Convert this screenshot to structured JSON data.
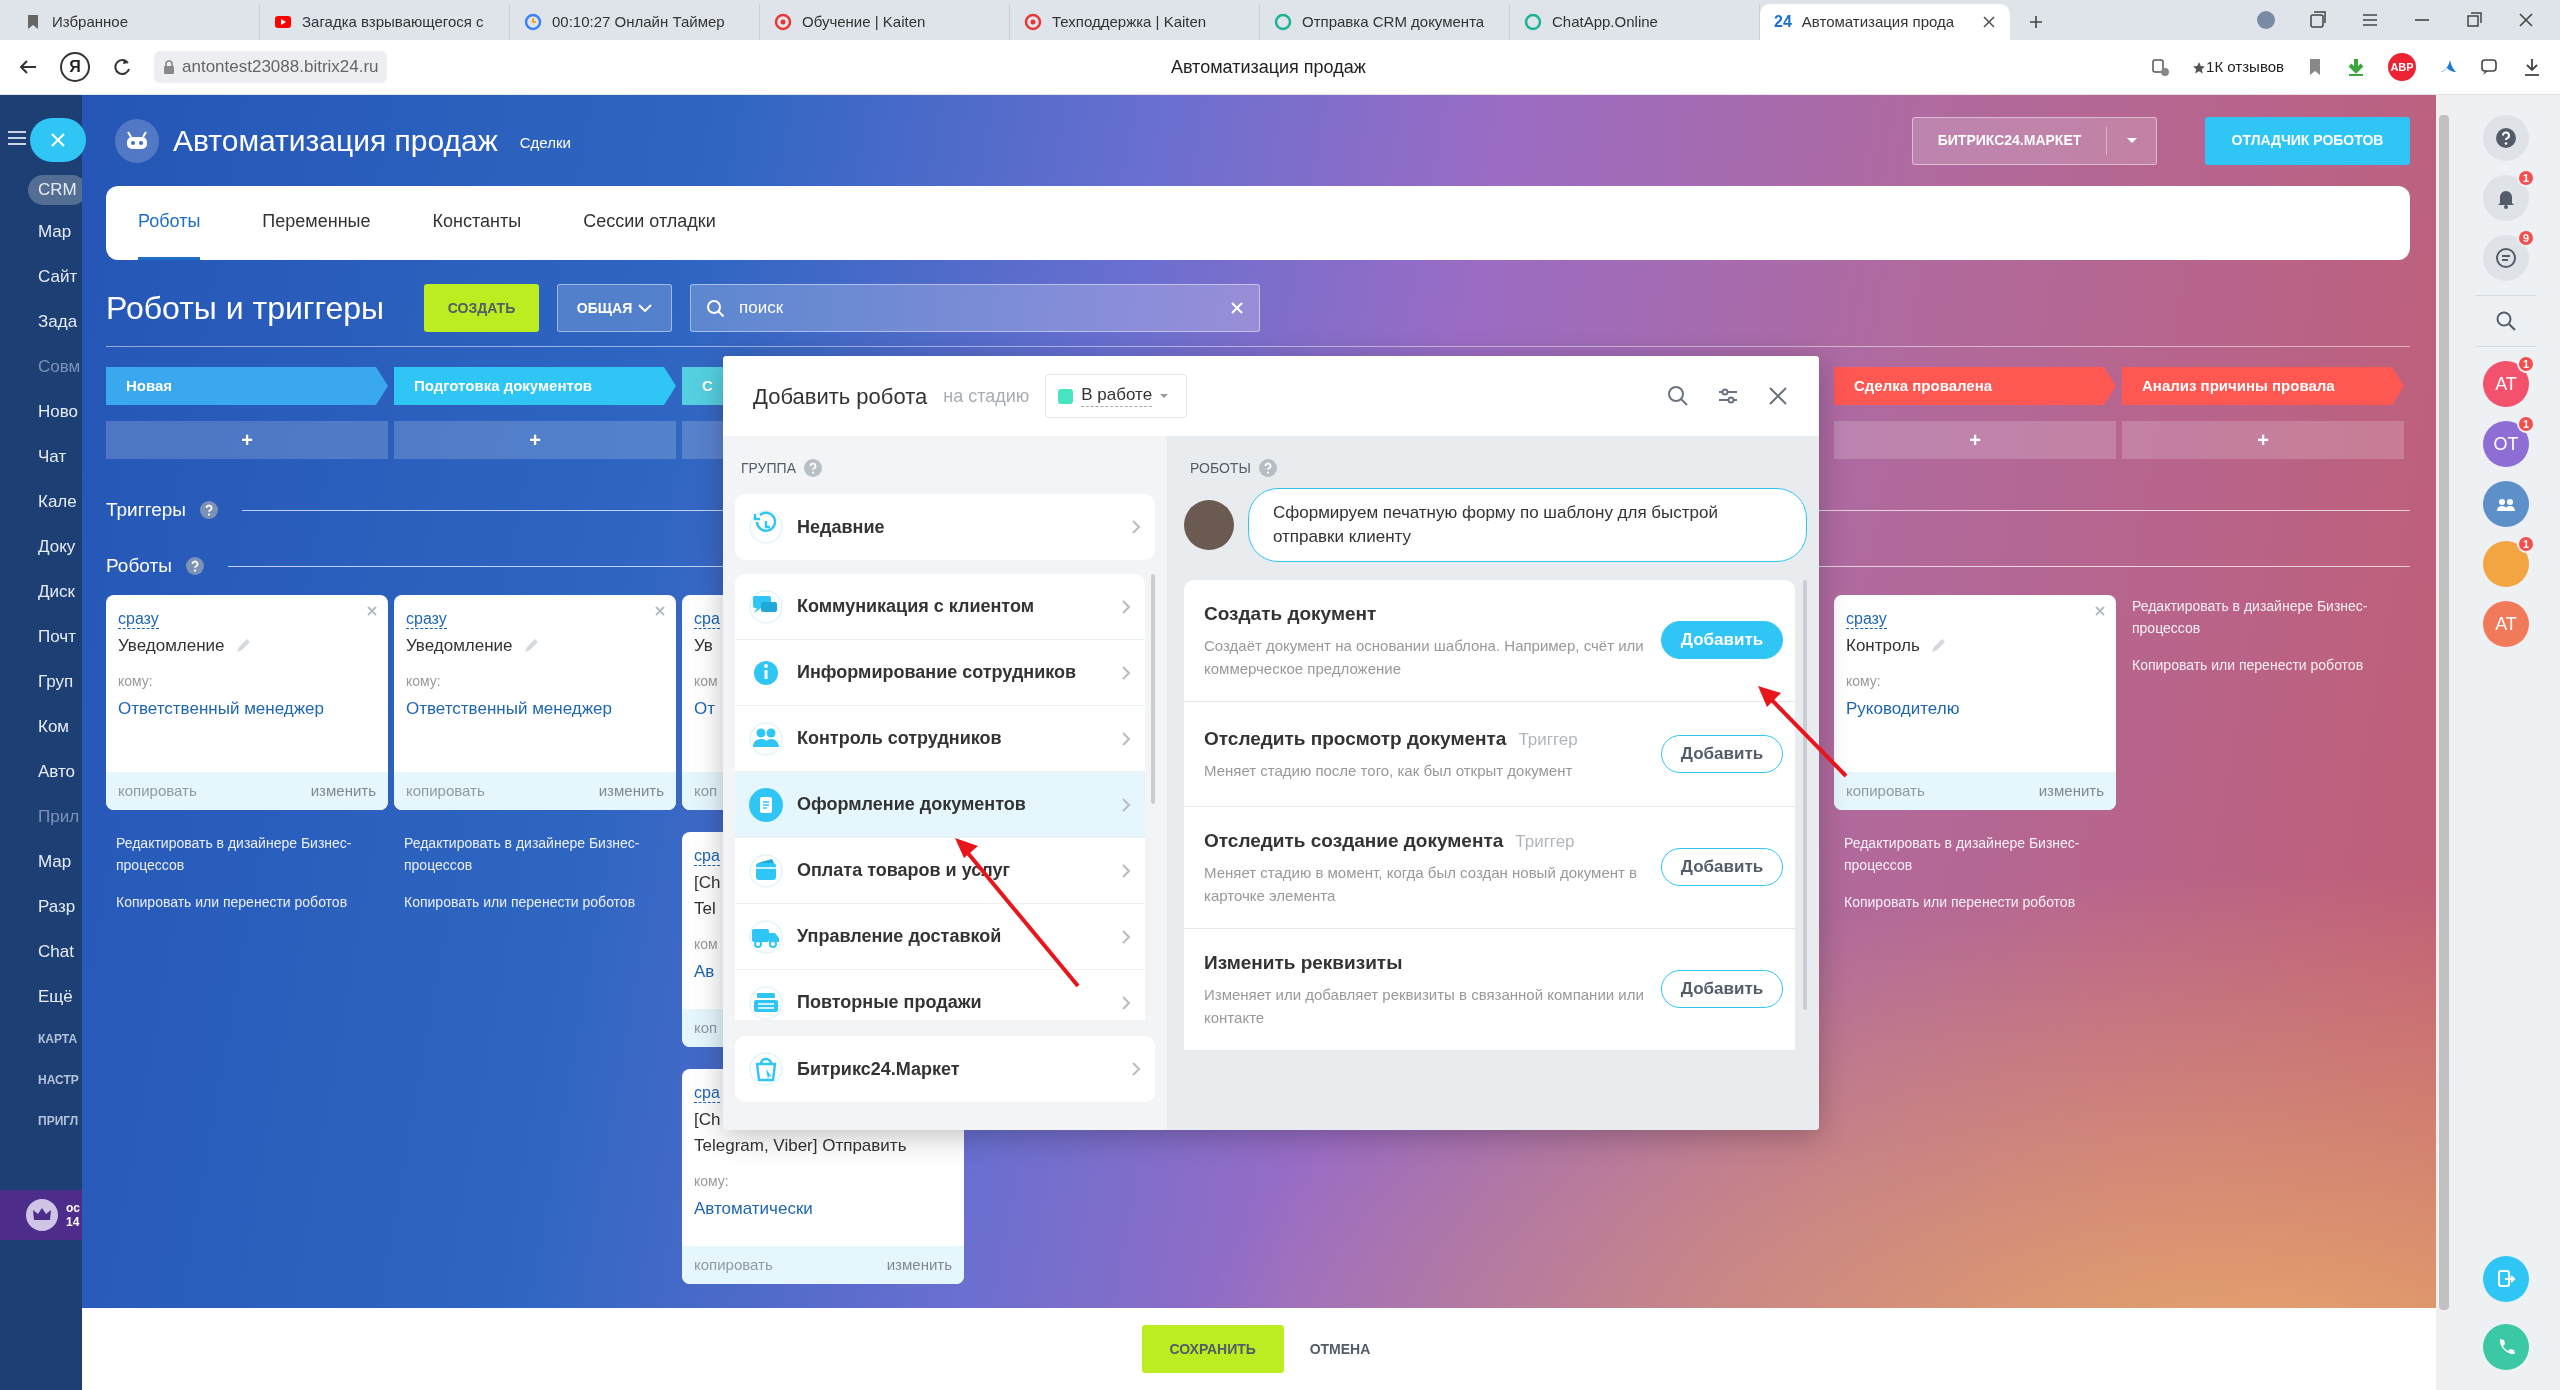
{
  "browser": {
    "tabs": [
      {
        "title": "Избранное",
        "selected": false
      },
      {
        "title": "Загадка взрывающегося с",
        "selected": false
      },
      {
        "title": "00:10:27 Онлайн Таймер",
        "selected": false
      },
      {
        "title": "Обучение | Kaiten",
        "selected": false
      },
      {
        "title": "Техподдержка | Kaiten",
        "selected": false
      },
      {
        "title": "Отправка CRM документа",
        "selected": false
      },
      {
        "title": "ChatApp.Online",
        "selected": false
      },
      {
        "title": "Автоматизация прода",
        "favicon_text": "24",
        "selected": true
      }
    ],
    "home_button": "Я",
    "address": "antontest23088.bitrix24.ru",
    "page_title": "Автоматизация продаж",
    "reviews": "1К отзывов",
    "adblock": "ABP"
  },
  "sidebar": {
    "items": [
      {
        "label": "CRM",
        "kind": "item",
        "selected": true
      },
      {
        "label": "Мар",
        "kind": "item",
        "selected": false
      },
      {
        "label": "Сайт",
        "kind": "item",
        "selected": false
      },
      {
        "label": "Зада",
        "kind": "item",
        "selected": false
      },
      {
        "label": "Совм",
        "kind": "muted"
      },
      {
        "label": "Ново",
        "kind": "item",
        "selected": false
      },
      {
        "label": "Чат",
        "kind": "item",
        "selected": false
      },
      {
        "label": "Кале",
        "kind": "item",
        "selected": false
      },
      {
        "label": "Доку",
        "kind": "item",
        "selected": false
      },
      {
        "label": "Диск",
        "kind": "item",
        "selected": false
      },
      {
        "label": "Почт",
        "kind": "item",
        "selected": false
      },
      {
        "label": "Груп",
        "kind": "item",
        "selected": false
      },
      {
        "label": "Ком",
        "kind": "item",
        "selected": false
      },
      {
        "label": "Авто",
        "kind": "item",
        "selected": false
      },
      {
        "label": "Прил",
        "kind": "muted"
      },
      {
        "label": "Мар",
        "kind": "item",
        "selected": false
      },
      {
        "label": "Разр",
        "kind": "item",
        "selected": false
      },
      {
        "label": "Chat",
        "kind": "item",
        "selected": false
      },
      {
        "label": "Ещё",
        "kind": "item",
        "selected": false
      },
      {
        "label": "КАРТА",
        "kind": "caption"
      },
      {
        "label": "НАСТР",
        "kind": "caption"
      },
      {
        "label": "ПРИГЛ",
        "kind": "caption"
      }
    ],
    "promo": {
      "line_1": "ос",
      "line_2": "14"
    }
  },
  "header": {
    "title": "Автоматизация продаж",
    "subtitle": "Сделки",
    "market_button": "БИТРИКС24.МАРКЕТ",
    "debugger_button": "ОТЛАДЧИК РОБОТОВ"
  },
  "tabs": [
    {
      "label": "Роботы",
      "selected": true
    },
    {
      "label": "Переменные",
      "selected": false
    },
    {
      "label": "Константы",
      "selected": false
    },
    {
      "label": "Сессии отладки",
      "selected": false
    }
  ],
  "toolbar": {
    "title": "Роботы и триггеры",
    "create_button": "СОЗДАТЬ",
    "filter_button": "ОБЩАЯ",
    "search": {
      "placeholder": "поиск"
    }
  },
  "sections": {
    "triggers": "Триггеры",
    "robots": "Роботы"
  },
  "board": {
    "left_stages": [
      {
        "name": "Новая",
        "color": "#39a8ef",
        "add": "+",
        "cards": [
          {
            "delay": "сразу",
            "title_lines": [
              "Уведомление"
            ],
            "to_label": "кому:",
            "recipient": "Ответственный менеджер",
            "copy": "копировать",
            "edit": "изменить"
          }
        ],
        "links": [
          "Редактировать в дизайнере Бизнес-процессов",
          "Копировать или перенести роботов"
        ]
      },
      {
        "name": "Подготовка документов",
        "color": "#2fc6f6",
        "add": "+",
        "cards": [
          {
            "delay": "сразу",
            "title_lines": [
              "Уведомление"
            ],
            "to_label": "кому:",
            "recipient": "Ответственный менеджер",
            "copy": "копировать",
            "edit": "изменить"
          }
        ],
        "links": [
          "Редактировать в дизайнере Бизнес-процессов",
          "Копировать или перенести роботов"
        ]
      },
      {
        "name": "С",
        "color": "#55d0e0",
        "cards": [
          {
            "delay": "сра",
            "title_lines": [
              "Ув"
            ],
            "to_label": "ком",
            "recipient": "От",
            "copy": "коп"
          },
          {
            "delay": "сра",
            "title_lines": [
              "[Ch",
              "Tel"
            ],
            "to_label": "ком",
            "recipient": "Ав",
            "copy": "коп"
          },
          {
            "delay": "сра",
            "title_lines": [
              "[Ch",
              "Telegram, Viber] Отправить"
            ],
            "to_label": "кому:",
            "recipient": "Автоматически",
            "copy": "копировать",
            "edit": "изменить"
          }
        ]
      }
    ],
    "right_stages": [
      {
        "name": "Сделка провалена",
        "color": "#ff5752",
        "add": "+",
        "cards": [
          {
            "delay": "сразу",
            "title_lines": [
              "Контроль"
            ],
            "to_label": "кому:",
            "recipient": "Руководителю",
            "copy": "копировать",
            "edit": "изменить"
          }
        ],
        "links": [
          "Редактировать в дизайнере Бизнес-процессов",
          "Копировать или перенести роботов"
        ]
      },
      {
        "name": "Анализ причины провала",
        "color": "#ff5752",
        "add": "+",
        "links": [
          "Редактировать в дизайнере Бизнес-процессов",
          "Копировать или перенести роботов"
        ]
      }
    ]
  },
  "footer": {
    "save_button": "СОХРАНИТЬ",
    "cancel_button": "ОТМЕНА"
  },
  "modal": {
    "title": "Добавить робота",
    "stage_label": "на стадию",
    "stage": {
      "name": "В работе",
      "color": "#47e4c2"
    },
    "group_heading": "ГРУППА",
    "recent": "Недавние",
    "groups": [
      {
        "label": "Коммуникация с клиентом",
        "selected": false
      },
      {
        "label": "Информирование сотрудников",
        "selected": false
      },
      {
        "label": "Контроль сотрудников",
        "selected": false
      },
      {
        "label": "Оформление документов",
        "selected": true
      },
      {
        "label": "Оплата товаров и услуг",
        "selected": false
      },
      {
        "label": "Управление доставкой",
        "selected": false
      },
      {
        "label": "Повторные продажи",
        "selected": false
      }
    ],
    "market": "Битрикс24.Маркет",
    "robots_heading": "РОБОТЫ",
    "hint": "Сформируем печатную форму по шаблону для быстрой отправки клиенту",
    "robots": [
      {
        "title": "Создать документ",
        "description": "Создаёт документ на основании шаблона. Например, счёт или коммерческое предложение",
        "button": "Добавить",
        "highlighted": true
      },
      {
        "title": "Отследить просмотр документа",
        "tag": "Триггер",
        "description": "Меняет стадию после того, как был открыт документ",
        "button": "Добавить",
        "highlighted": false
      },
      {
        "title": "Отследить создание документа",
        "tag": "Триггер",
        "description": "Меняет стадию в момент, когда был создан новый документ в карточке элемента",
        "button": "Добавить",
        "highlighted": false
      },
      {
        "title": "Изменить реквизиты",
        "description": "Изменяет или добавляет реквизиты в связанной компании или контакте",
        "button": "Добавить",
        "highlighted": false
      }
    ]
  },
  "right_bar": {
    "notifications_badge": "1",
    "chat_badge": "9",
    "contacts": [
      {
        "kind": "initials",
        "initials": "АТ",
        "color": "#f4516c",
        "badge": "1"
      },
      {
        "kind": "initials",
        "initials": "ОТ",
        "color": "#8e6dd4",
        "badge": "1"
      },
      {
        "kind": "group",
        "color": "#5d8fc9"
      },
      {
        "kind": "photo",
        "color": "#f2a541",
        "badge": "1"
      },
      {
        "kind": "initials",
        "initials": "АТ",
        "color": "#f07a5a"
      }
    ]
  }
}
